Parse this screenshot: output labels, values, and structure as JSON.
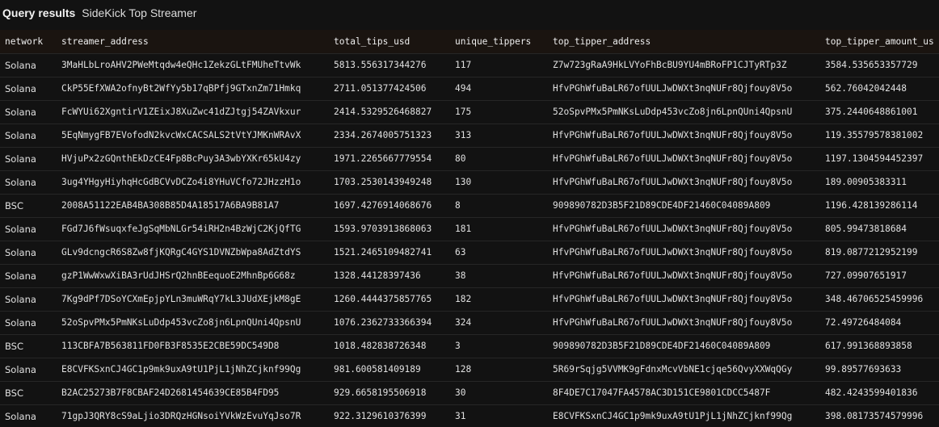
{
  "header": {
    "label": "Query results",
    "query_name": "SideKick Top Streamer"
  },
  "table": {
    "columns": [
      "network",
      "streamer_address",
      "total_tips_usd",
      "unique_tippers",
      "top_tipper_address",
      "top_tipper_amount_us"
    ],
    "rows": [
      [
        "Solana",
        "3MaHLbLroAHV2PWeMtqdw4eQHc1ZekzGLtFMUheTtvWk",
        "5813.556317344276",
        "117",
        "Z7w723gRaA9HkLVYoFhBcBU9YU4mBRoFP1CJTyRTp3Z",
        "3584.535653357729"
      ],
      [
        "Solana",
        "CkP55EfXWA2ofnyBt2WfYy5b17qBPfj9GTxnZm71Hmkq",
        "2711.051377424506",
        "494",
        "HfvPGhWfuBaLR67ofUULJwDWXt3nqNUFr8Qjfouy8V5o",
        "562.76042042448"
      ],
      [
        "Solana",
        "FcWYUi62XgntirV1ZEixJ8XuZwc41dZJtgj54ZAVkxur",
        "2414.5329526468827",
        "175",
        "52oSpvPMx5PmNKsLuDdp453vcZo8jn6LpnQUni4QpsnU",
        "375.2440648861001"
      ],
      [
        "Solana",
        "5EqNmygFB7EVofodN2kvcWxCACSALS2tVtYJMKnWRAvX",
        "2334.2674005751323",
        "313",
        "HfvPGhWfuBaLR67ofUULJwDWXt3nqNUFr8Qjfouy8V5o",
        "119.35579578381002"
      ],
      [
        "Solana",
        "HVjuPx2zGQnthEkDzCE4Fp8BcPuy3A3wbYXKr65kU4zy",
        "1971.2265667779554",
        "80",
        "HfvPGhWfuBaLR67ofUULJwDWXt3nqNUFr8Qjfouy8V5o",
        "1197.1304594452397"
      ],
      [
        "Solana",
        "3ug4YHgyHiyhqHcGdBCVvDCZo4i8YHuVCfo72JHzzH1o",
        "1703.2530143949248",
        "130",
        "HfvPGhWfuBaLR67ofUULJwDWXt3nqNUFr8Qjfouy8V5o",
        "189.00905383311"
      ],
      [
        "BSC",
        "2008A51122EAB4BA308B85D4A18517A6BA9B81A7",
        "1697.4276914068676",
        "8",
        "909890782D3B5F21D89CDE4DF21460C04089A809",
        "1196.428139286114"
      ],
      [
        "Solana",
        "FGd7J6fWsuqxfeJgSqMbNLGr54iRH2n4BzWjC2KjQfTG",
        "1593.9703913868063",
        "181",
        "HfvPGhWfuBaLR67ofUULJwDWXt3nqNUFr8Qjfouy8V5o",
        "805.99473818684"
      ],
      [
        "Solana",
        "GLv9dcngcR6S8Zw8fjKQRgC4GYS1DVNZbWpa8AdZtdYS",
        "1521.2465109482741",
        "63",
        "HfvPGhWfuBaLR67ofUULJwDWXt3nqNUFr8Qjfouy8V5o",
        "819.0877212952199"
      ],
      [
        "Solana",
        "gzP1WwWxwXiBA3rUdJHSrQ2hnBEequoE2MhnBp6G68z",
        "1328.44128397436",
        "38",
        "HfvPGhWfuBaLR67ofUULJwDWXt3nqNUFr8Qjfouy8V5o",
        "727.09907651917"
      ],
      [
        "Solana",
        "7Kg9dPf7DSoYCXmEpjpYLn3muWRqY7kL3JUdXEjkM8gE",
        "1260.4444375857765",
        "182",
        "HfvPGhWfuBaLR67ofUULJwDWXt3nqNUFr8Qjfouy8V5o",
        "348.46706525459996"
      ],
      [
        "Solana",
        "52oSpvPMx5PmNKsLuDdp453vcZo8jn6LpnQUni4QpsnU",
        "1076.2362733366394",
        "324",
        "HfvPGhWfuBaLR67ofUULJwDWXt3nqNUFr8Qjfouy8V5o",
        "72.49726484084"
      ],
      [
        "BSC",
        "113CBFA7B563811FD0FB3F8535E2CBE59DC549D8",
        "1018.482838726348",
        "3",
        "909890782D3B5F21D89CDE4DF21460C04089A809",
        "617.991368893858"
      ],
      [
        "Solana",
        "E8CVFKSxnCJ4GC1p9mk9uxA9tU1PjL1jNhZCjknf99Qg",
        "981.600581409189",
        "128",
        "5R69rSqjg5VVMK9gFdnxMcvVbNE1cjqe56QvyXXWqQGy",
        "99.89577693633"
      ],
      [
        "BSC",
        "B2AC25273B7F8CBAF24D2681454639CE85B4FD95",
        "929.6658195506918",
        "30",
        "8F4DE7C17047FA4578AC3D151CE9801CDCC5487F",
        "482.4243599401836"
      ],
      [
        "Solana",
        "71gpJ3QRY8cS9aLjio3DRQzHGNsoiYVkWzEvuYqJso7R",
        "922.3129610376399",
        "31",
        "E8CVFKSxnCJ4GC1p9mk9uxA9tU1PjL1jNhZCjknf99Qg",
        "398.08173574579996"
      ]
    ]
  }
}
